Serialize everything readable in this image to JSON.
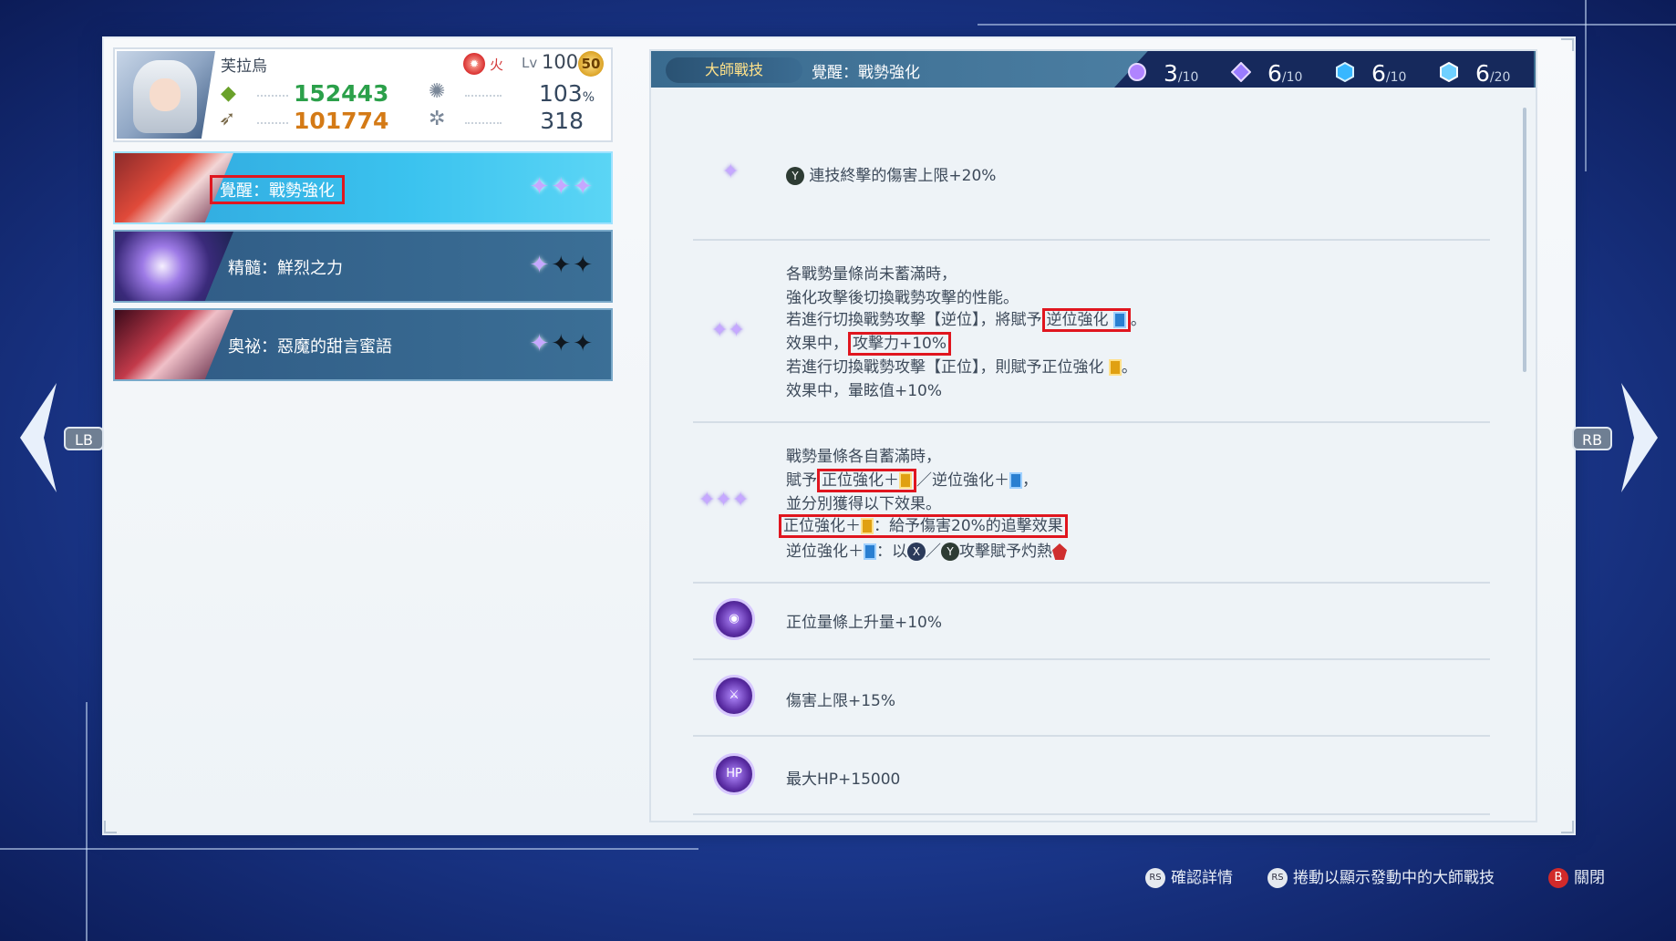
{
  "character": {
    "name": "芙拉烏",
    "element_label": "火",
    "element_icon": "fire-element-icon",
    "level_label": "Lv",
    "level": "100",
    "badge": "50",
    "hp": "152443",
    "attack": "101774",
    "crit_rate": "103",
    "crit_unit": "%",
    "stun": "318"
  },
  "skills": [
    {
      "label": "覺醒：戰勢強化",
      "stars_on": 3,
      "stars_total": 3
    },
    {
      "label": "精髓：鮮烈之力",
      "stars_on": 1,
      "stars_total": 3
    },
    {
      "label": "奧祕：惡魔的甜言蜜語",
      "stars_on": 1,
      "stars_total": 3
    }
  ],
  "panel": {
    "tab_label": "大師戰技",
    "title": "覺醒：戰勢強化",
    "counts": [
      {
        "value": "3",
        "max": "/10",
        "color": "#b084ff"
      },
      {
        "value": "6",
        "max": "/10",
        "color": "#9a7cff"
      },
      {
        "value": "6",
        "max": "/10",
        "color": "#37b7ff"
      },
      {
        "value": "6",
        "max": "/20",
        "color": "#6fd0ff"
      }
    ]
  },
  "sections": {
    "s1": {
      "btn": "Y",
      "text": "連技終擊的傷害上限+20%"
    },
    "s2": {
      "l1": "各戰勢量條尚未蓄滿時，",
      "l2": "強化攻擊後切換戰勢攻擊的性能。",
      "l3a": "若進行切換戰勢攻擊【逆位】，將賦予",
      "l3b": "逆位強化",
      "l3c": "。",
      "l4a": "效果中，",
      "l4b": "攻擊力+10%",
      "l5a": "若進行切換戰勢攻擊【正位】，則賦予正位強化",
      "l5b": "。",
      "l6": "效果中，暈眩值+10%"
    },
    "s3": {
      "l1": "戰勢量條各自蓄滿時，",
      "l2a": "賦予",
      "l2b": "正位強化＋",
      "l2c": "／逆位強化＋",
      "l2d": "，",
      "l3": "並分別獲得以下效果。",
      "l4a": "正位強化＋",
      "l4b": "：給予傷害20%的追擊效果",
      "l5a": "逆位強化＋",
      "l5b": "：以",
      "l5c": "X",
      "l5d": "／",
      "l5e": "Y",
      "l5f": "攻擊賦予灼熱"
    },
    "s4": {
      "text": "正位量條上升量+10%"
    },
    "s5": {
      "text": "傷害上限+15%"
    },
    "s6": {
      "text": "最大HP+15000",
      "icon_text": "HP"
    }
  },
  "nav": {
    "left": "LB",
    "right": "RB"
  },
  "footer": {
    "confirm": "確認詳情",
    "scroll": "捲動以顯示發動中的大師戰技",
    "close": "關閉",
    "rs": "RS",
    "b": "B"
  }
}
